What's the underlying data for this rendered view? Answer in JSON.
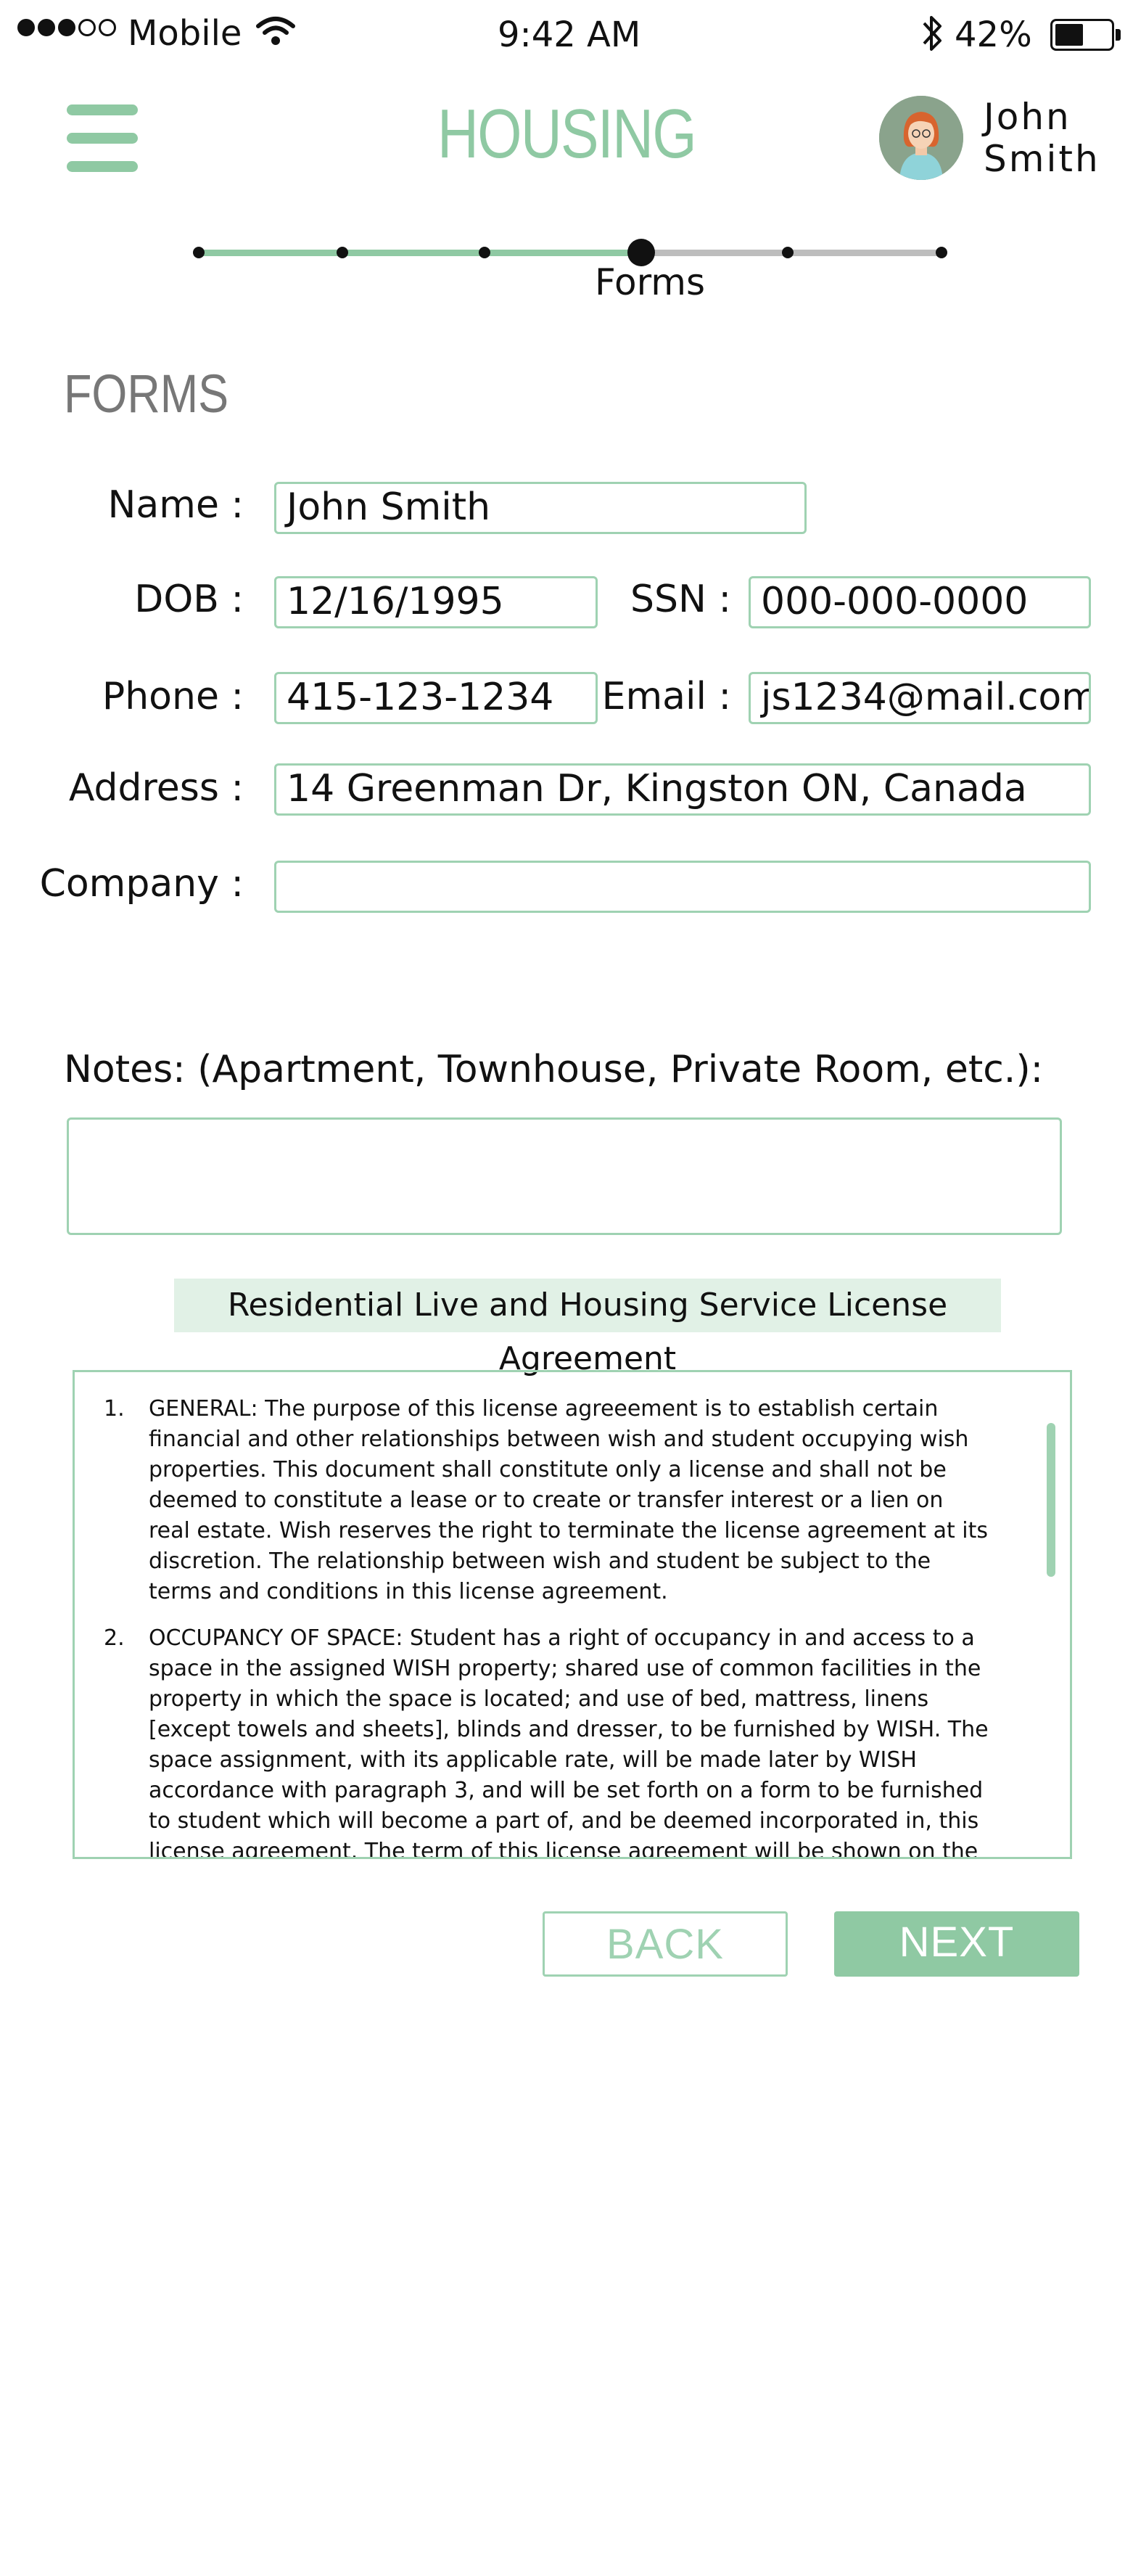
{
  "status_bar": {
    "carrier": "Mobile",
    "time": "9:42 AM",
    "battery_percent": "42%",
    "signal_bars_filled": 3,
    "signal_bars_total": 5,
    "battery_level": 0.42
  },
  "header": {
    "title": "HOUSING",
    "user_first_name": "John",
    "user_last_name": "Smith"
  },
  "progress": {
    "current_step_label": "Forms",
    "total_steps": 6,
    "current_step": 4
  },
  "section_title": "FORMS",
  "form": {
    "name_label": "Name :",
    "name_value": "John Smith",
    "dob_label": "DOB :",
    "dob_value": "12/16/1995",
    "ssn_label": "SSN :",
    "ssn_value": "000-000-0000",
    "phone_label": "Phone :",
    "phone_value": "415-123-1234",
    "email_label": "Email :",
    "email_value": "js1234@mail.com",
    "address_label": "Address :",
    "address_value": "14 Greenman Dr, Kingston ON, Canada",
    "company_label": "Company :",
    "company_value": ""
  },
  "notes": {
    "label": "Notes: (Apartment, Townhouse, Private Room, etc.):",
    "value": ""
  },
  "agreement": {
    "title": "Residential Live and Housing Service License Agreement",
    "clauses": [
      {
        "number": "1.",
        "text": "GENERAL: The purpose of this license agreeement is to establish certain financial and other relationships between wish and student occupying wish properties. This document shall constitute only a license and shall not be deemed to constitute a lease or to create or transfer interest or a lien on real estate. Wish reserves the right to terminate the license agreement at its discretion. The relationship between wish and student be subject to the terms and conditions in this license agreement."
      },
      {
        "number": "2.",
        "text": "OCCUPANCY OF SPACE: Student has a right of occupancy in and access to a space in the assigned WISH property; shared use of common facilities in the property in which the space is located; and use of bed, mattress, linens [except towels and sheets], blinds and dresser, to be furnished by WISH. The space assignment, with its applicable rate, will be made later by WISH accordance with paragraph 3, and will be set forth on a form to be furnished to student which will become a part of, and be deemed incorporated in, this license agreement.  The term of this license agreement will be shown on the assignment as specified above.  The term will be the period of time covered by the summer and fall and/or spring semesters, subject to other"
      }
    ]
  },
  "buttons": {
    "back_label": "BACK",
    "next_label": "NEXT"
  },
  "colors": {
    "accent": "#8fc9a3",
    "field_border": "#9fd2b2",
    "agreement_title_bg": "#e1f1e6",
    "track_inactive": "#bdbdbd"
  }
}
